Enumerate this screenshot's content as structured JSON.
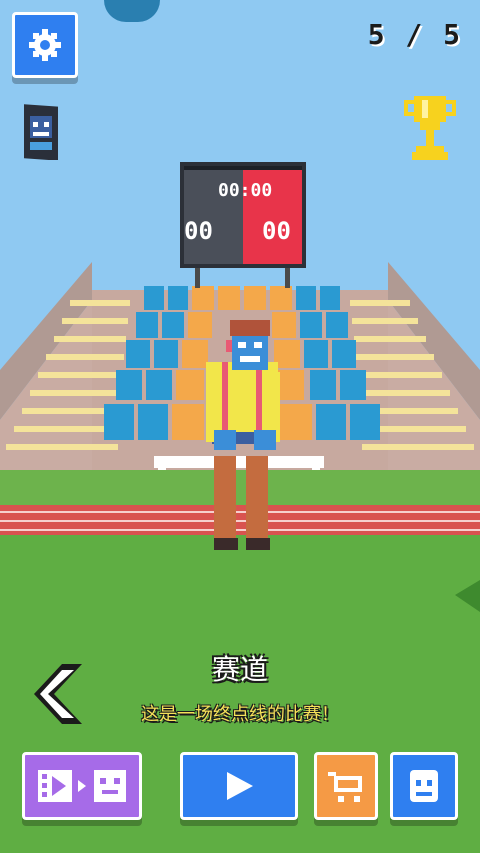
{
  "hud": {
    "settings_icon": "gear-icon",
    "counter": "5 / 5",
    "trophy_icon": "trophy-icon",
    "character_card_icon": "character-card-icon"
  },
  "scoreboard": {
    "time": "00:00",
    "left_score": "00",
    "right_score": "00"
  },
  "track": {
    "title": "赛道",
    "description": "这是一场终点线的比赛！"
  },
  "buttons": {
    "back_icon": "chevron-left-icon",
    "video_icon": "film-to-character-icon",
    "play_icon": "play-icon",
    "shop_icon": "shopping-cart-icon",
    "character_icon": "character-face-icon"
  },
  "colors": {
    "button_blue": "#2f7ff0",
    "button_purple": "#a66be8",
    "button_orange": "#f59a45",
    "trophy_gold": "#f7d21e",
    "scoreboard_red": "#e8344a",
    "grass": "#5fae43",
    "track_red": "#d9534f"
  }
}
